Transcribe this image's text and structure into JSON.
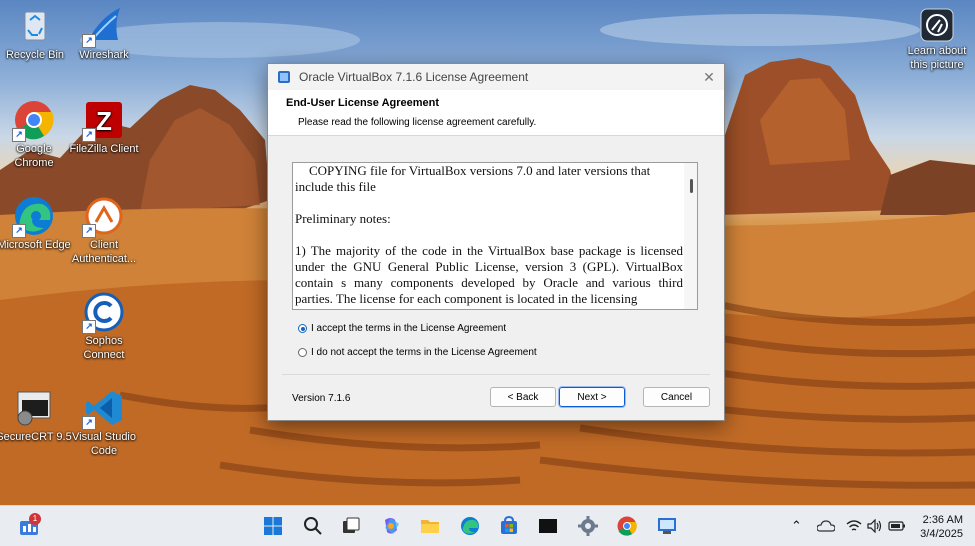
{
  "desktop": {
    "icons": [
      {
        "label": "Recycle Bin",
        "icon": "recycle-bin-icon"
      },
      {
        "label": "Wireshark",
        "icon": "wireshark-icon"
      },
      {
        "label": "Google Chrome",
        "icon": "chrome-icon"
      },
      {
        "label": "FileZilla Client",
        "icon": "filezilla-icon"
      },
      {
        "label": "Microsoft Edge",
        "icon": "edge-icon"
      },
      {
        "label": "Client Authenticat...",
        "icon": "client-authenticator-icon"
      },
      {
        "label": "Sophos Connect",
        "icon": "sophos-connect-icon"
      },
      {
        "label": "SecureCRT 9.5",
        "icon": "securecrt-icon"
      },
      {
        "label": "Visual Studio Code",
        "icon": "vscode-icon"
      }
    ],
    "learn_about": "Learn about this picture"
  },
  "dialog": {
    "title": "Oracle VirtualBox 7.1.6 License Agreement",
    "header_title": "End-User License Agreement",
    "header_subtitle": "Please read the following license agreement carefully.",
    "license_paragraphs": [
      "COPYING file for VirtualBox versions 7.0 and later versions that include this file",
      "Preliminary notes:",
      "1)  The majority of the code in the VirtualBox base package is licensed under the GNU General Public License, version 3  (GPL).  VirtualBox contain s many components developed by Oracle and various third parties. The license for each component is located in the licensing"
    ],
    "accept_label": "I accept the terms in the License Agreement",
    "decline_label": "I do not accept the terms in the License Agreement",
    "accept_selected": true,
    "version": "Version 7.1.6",
    "back_label": "< Back",
    "next_label": "Next >",
    "cancel_label": "Cancel"
  },
  "taskbar": {
    "widget_badge": "1",
    "apps": [
      "start-icon",
      "search-icon",
      "task-view-icon",
      "copilot-icon",
      "file-explorer-icon",
      "edge-icon",
      "store-icon",
      "terminal-icon",
      "settings-icon",
      "chrome-icon",
      "virtualbox-icon"
    ],
    "time": "2:36 AM",
    "date": "3/4/2025"
  },
  "colors": {
    "accent": "#1565c0",
    "taskbar_bg": "#e9ecf1"
  }
}
